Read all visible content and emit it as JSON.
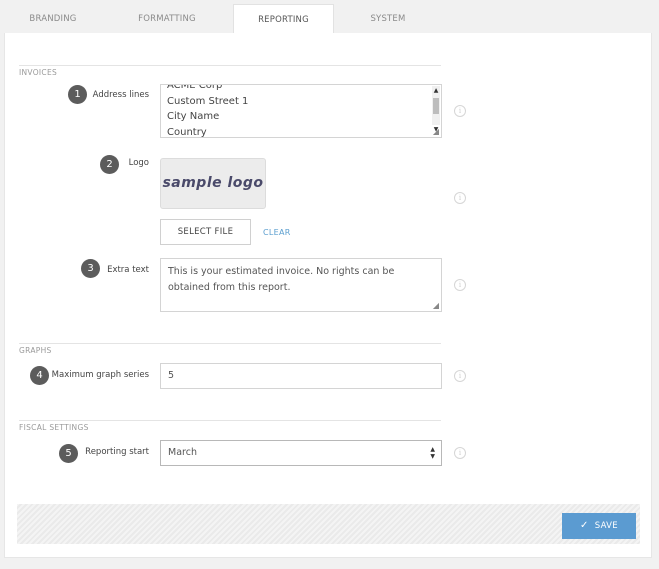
{
  "tabs": [
    {
      "label": "BRANDING"
    },
    {
      "label": "FORMATTING"
    },
    {
      "label": "REPORTING"
    },
    {
      "label": "SYSTEM"
    }
  ],
  "active_tab": "REPORTING",
  "sections": {
    "invoices": "INVOICES",
    "graphs": "GRAPHS",
    "fiscal": "FISCAL SETTINGS"
  },
  "fields": {
    "address": {
      "number": "1",
      "label": "Address lines",
      "lines": [
        "ACME Corp",
        "Custom Street 1",
        "City Name",
        "Country"
      ]
    },
    "logo": {
      "number": "2",
      "label": "Logo",
      "image_text": "sample logo",
      "select_label": "SELECT FILE",
      "clear_label": "CLEAR"
    },
    "extra_text": {
      "number": "3",
      "label": "Extra text",
      "value": "This is your estimated invoice. No rights can be obtained from this report."
    },
    "max_series": {
      "number": "4",
      "label": "Maximum graph series",
      "value": "5"
    },
    "reporting_start": {
      "number": "5",
      "label": "Reporting start",
      "value": "March"
    }
  },
  "info_icon": "info-icon",
  "footer": {
    "save_label": "SAVE",
    "save_icon": "check-icon"
  },
  "colors": {
    "accent": "#5b9bd1",
    "badge": "#5c5c5c",
    "link": "#5b9ecf"
  }
}
